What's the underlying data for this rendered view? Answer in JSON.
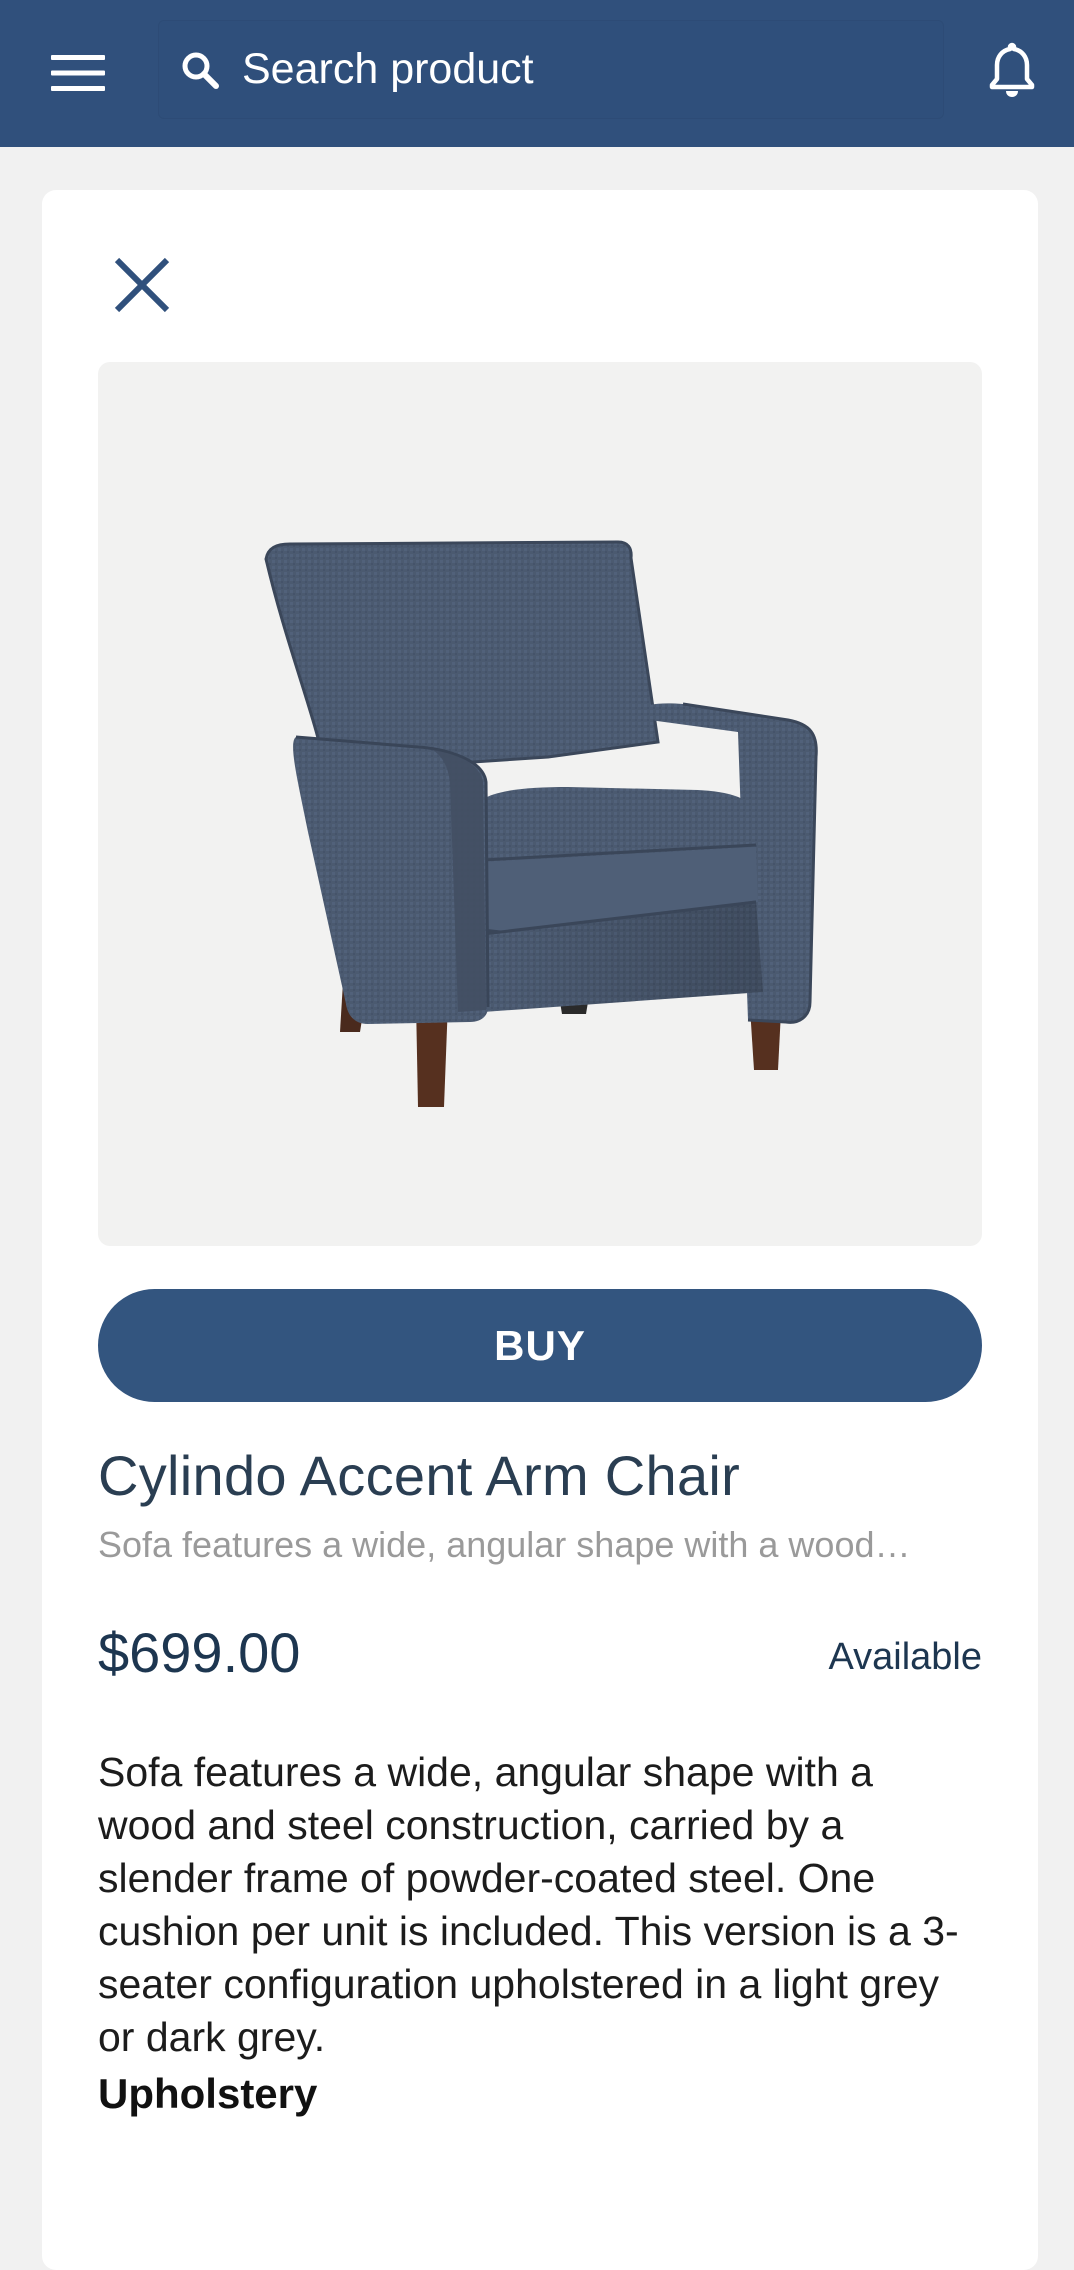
{
  "header": {
    "menu_icon": "hamburger-menu-icon",
    "search_icon": "search-icon",
    "search_placeholder": "Search product",
    "notification_icon": "bell-icon",
    "bar_color": "#30507c"
  },
  "product": {
    "close_icon": "close-icon",
    "image_alt": "chair-product-image",
    "buy_label": "BUY",
    "name": "Cylindo Accent Arm Chair",
    "short_description": "Sofa features a wide, angular shape with a wood…",
    "price": "$699.00",
    "availability": "Available",
    "description": "Sofa features a wide, angular shape with a wood and steel construction, carried by a slender frame of powder-coated steel. One cushion per unit is included. This version is a 3-seater configuration upholstered in a light grey or dark grey.",
    "section_heading": "Upholstery",
    "accent_color": "#33557f"
  }
}
